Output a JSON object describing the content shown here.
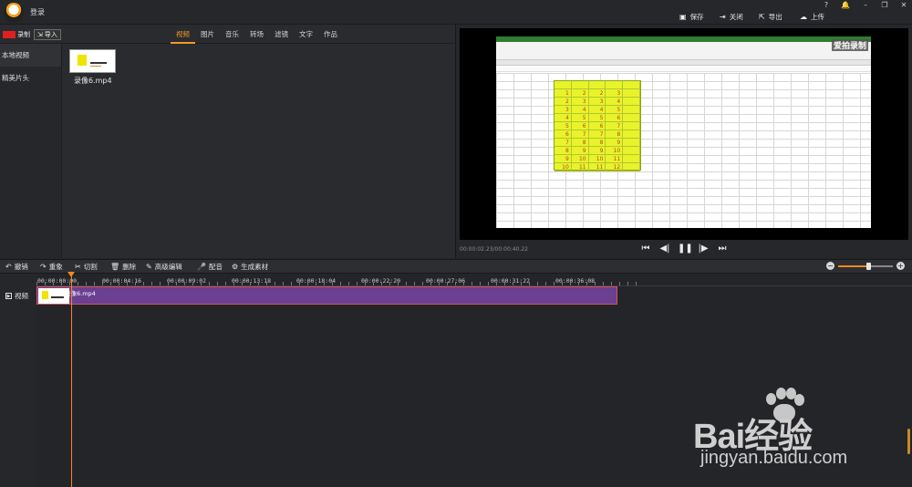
{
  "header": {
    "user_label": "登录",
    "actions": [
      {
        "label": "保存",
        "icon": "save-icon"
      },
      {
        "label": "关闭",
        "icon": "close-icon"
      },
      {
        "label": "导出",
        "icon": "export-icon"
      },
      {
        "label": "上传",
        "icon": "upload-icon"
      }
    ],
    "window_controls": [
      "?",
      "🔔",
      "–",
      "❐",
      "✕"
    ]
  },
  "library": {
    "record_label": "录制",
    "import_label": "导入",
    "tabs": [
      "视频",
      "图片",
      "音乐",
      "转场",
      "滤镜",
      "文字",
      "作品"
    ],
    "active_tab": "视频",
    "sidebar": [
      "本地视频",
      "精美片头"
    ],
    "clip_name": "录像6.mp4"
  },
  "preview": {
    "time": "00:00:02.23/00:00:40.22",
    "watermark": "爱拍录制",
    "sheet_values": [
      [
        1,
        2,
        2,
        3
      ],
      [
        2,
        3,
        3,
        4
      ],
      [
        3,
        4,
        4,
        5
      ],
      [
        4,
        5,
        5,
        6
      ],
      [
        5,
        6,
        6,
        7
      ],
      [
        6,
        7,
        7,
        8
      ],
      [
        7,
        8,
        8,
        9
      ],
      [
        8,
        9,
        9,
        10
      ],
      [
        9,
        10,
        10,
        11
      ],
      [
        10,
        11,
        11,
        12
      ]
    ],
    "controls": [
      "prev",
      "step-back",
      "pause",
      "step-forward",
      "next"
    ]
  },
  "edit_toolbar": {
    "buttons": [
      {
        "label": "撤销",
        "icon": "undo-icon"
      },
      {
        "label": "重象",
        "icon": "redo-icon"
      },
      {
        "label": "切割",
        "icon": "cut-icon"
      },
      {
        "label": "删除",
        "icon": "delete-icon"
      },
      {
        "label": "高级编辑",
        "icon": "edit-icon"
      },
      {
        "label": "配音",
        "icon": "mic-icon"
      },
      {
        "label": "生成素材",
        "icon": "generate-icon"
      }
    ],
    "zoom_level": 0.55
  },
  "timeline": {
    "track_label": "视频",
    "ticks": [
      "00:00:00:00",
      "00:00:04:16",
      "00:00:09:02",
      "00:00:13:18",
      "00:00:18:04",
      "00:00:22:20",
      "00:00:27:06",
      "00:00:31:22",
      "00:00:36:08"
    ],
    "clip_label": "录像6.mp4"
  },
  "watermark": {
    "brand": "Bai经验",
    "url": "jingyan.baidu.com"
  },
  "colors": {
    "accent": "#f39a23",
    "clip": "#6b3f91",
    "record": "#e02020"
  }
}
